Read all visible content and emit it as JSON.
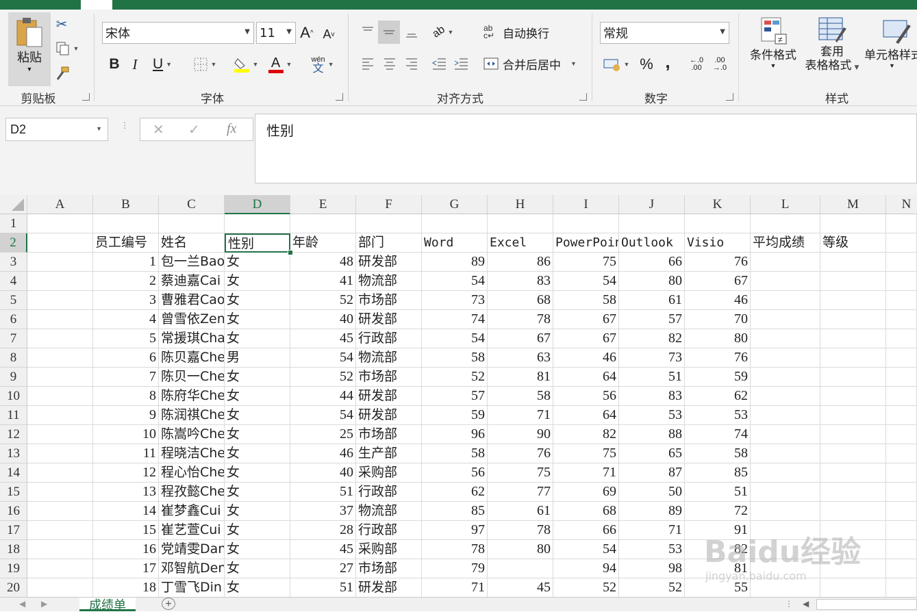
{
  "ribbon": {
    "clipboard": {
      "label": "剪贴板",
      "paste": "粘贴"
    },
    "font": {
      "label": "字体",
      "family": "宋体",
      "size": "11",
      "grow": "A",
      "shrink": "A",
      "bold": "B",
      "italic": "I",
      "underline": "U",
      "phonetic_top": "wén",
      "phonetic_bottom": "文"
    },
    "alignment": {
      "label": "对齐方式",
      "wrap_text": "自动换行",
      "merge_center": "合并后居中",
      "wrap_icon": "ab c"
    },
    "number": {
      "label": "数字",
      "format": "常规",
      "percent": "%",
      "comma": ",",
      "inc_decimal": "←.0 .00",
      "dec_decimal": ".00 →.0"
    },
    "styles": {
      "label": "样式",
      "conditional": "条件格式",
      "format_table_1": "套用",
      "format_table_2": "表格格式",
      "cell_styles": "单元格样式"
    }
  },
  "formula_bar": {
    "name_box": "D2",
    "cancel": "✕",
    "enter": "✓",
    "fx": "fx",
    "content": "性别"
  },
  "columns": [
    "A",
    "B",
    "C",
    "D",
    "E",
    "F",
    "G",
    "H",
    "I",
    "J",
    "K",
    "L",
    "M",
    "N"
  ],
  "rows": [
    "1",
    "2",
    "3",
    "4",
    "5",
    "6",
    "7",
    "8",
    "9",
    "10",
    "11",
    "12",
    "13",
    "14",
    "15",
    "16",
    "17",
    "18",
    "19",
    "20"
  ],
  "headers": [
    "员工编号",
    "姓名",
    "性别",
    "年龄",
    "部门",
    "Word",
    "Excel",
    "PowerPoint",
    "Outlook",
    "Visio",
    "平均成绩",
    "等级"
  ],
  "data": [
    [
      "1",
      "包一兰Bao",
      "女",
      "48",
      "研发部",
      "89",
      "86",
      "75",
      "66",
      "76"
    ],
    [
      "2",
      "蔡迪嘉Cai",
      "女",
      "41",
      "物流部",
      "54",
      "83",
      "54",
      "80",
      "67"
    ],
    [
      "3",
      "曹雅君Cao",
      "女",
      "52",
      "市场部",
      "73",
      "68",
      "58",
      "61",
      "46"
    ],
    [
      "4",
      "曾雪依Zen",
      "女",
      "40",
      "研发部",
      "74",
      "78",
      "67",
      "57",
      "70"
    ],
    [
      "5",
      "常援琪Cha",
      "女",
      "45",
      "行政部",
      "54",
      "67",
      "67",
      "82",
      "80"
    ],
    [
      "6",
      "陈贝嘉Che",
      "男",
      "54",
      "物流部",
      "58",
      "63",
      "46",
      "73",
      "76"
    ],
    [
      "7",
      "陈贝一Che",
      "女",
      "52",
      "市场部",
      "52",
      "81",
      "64",
      "51",
      "59"
    ],
    [
      "8",
      "陈府华Che",
      "女",
      "44",
      "研发部",
      "57",
      "58",
      "56",
      "83",
      "62"
    ],
    [
      "9",
      "陈润祺Che",
      "女",
      "54",
      "研发部",
      "59",
      "71",
      "64",
      "53",
      "53"
    ],
    [
      "10",
      "陈嵩吟Che",
      "女",
      "25",
      "市场部",
      "96",
      "90",
      "82",
      "88",
      "74"
    ],
    [
      "11",
      "程晓洁Che",
      "女",
      "46",
      "生产部",
      "58",
      "76",
      "75",
      "65",
      "58"
    ],
    [
      "12",
      "程心怡Che",
      "女",
      "40",
      "采购部",
      "56",
      "75",
      "71",
      "87",
      "85"
    ],
    [
      "13",
      "程孜懿Che",
      "女",
      "51",
      "行政部",
      "62",
      "77",
      "69",
      "50",
      "51"
    ],
    [
      "14",
      "崔梦鑫Cui",
      "女",
      "37",
      "物流部",
      "85",
      "61",
      "68",
      "89",
      "72"
    ],
    [
      "15",
      "崔艺萱Cui",
      "女",
      "28",
      "行政部",
      "97",
      "78",
      "66",
      "71",
      "91"
    ],
    [
      "16",
      "党靖雯Dan",
      "女",
      "45",
      "采购部",
      "78",
      "80",
      "54",
      "53",
      "82"
    ],
    [
      "17",
      "邓智航Den",
      "女",
      "27",
      "市场部",
      "79",
      "",
      "94",
      "98",
      "81"
    ],
    [
      "18",
      "丁雪飞Din",
      "女",
      "51",
      "研发部",
      "71",
      "45",
      "52",
      "52",
      "55"
    ]
  ],
  "sheet_tab": "成绩单",
  "watermark": {
    "main": "Baidu经验",
    "sub": "jingyan.baidu.com"
  },
  "colors": {
    "accent": "#217346"
  }
}
